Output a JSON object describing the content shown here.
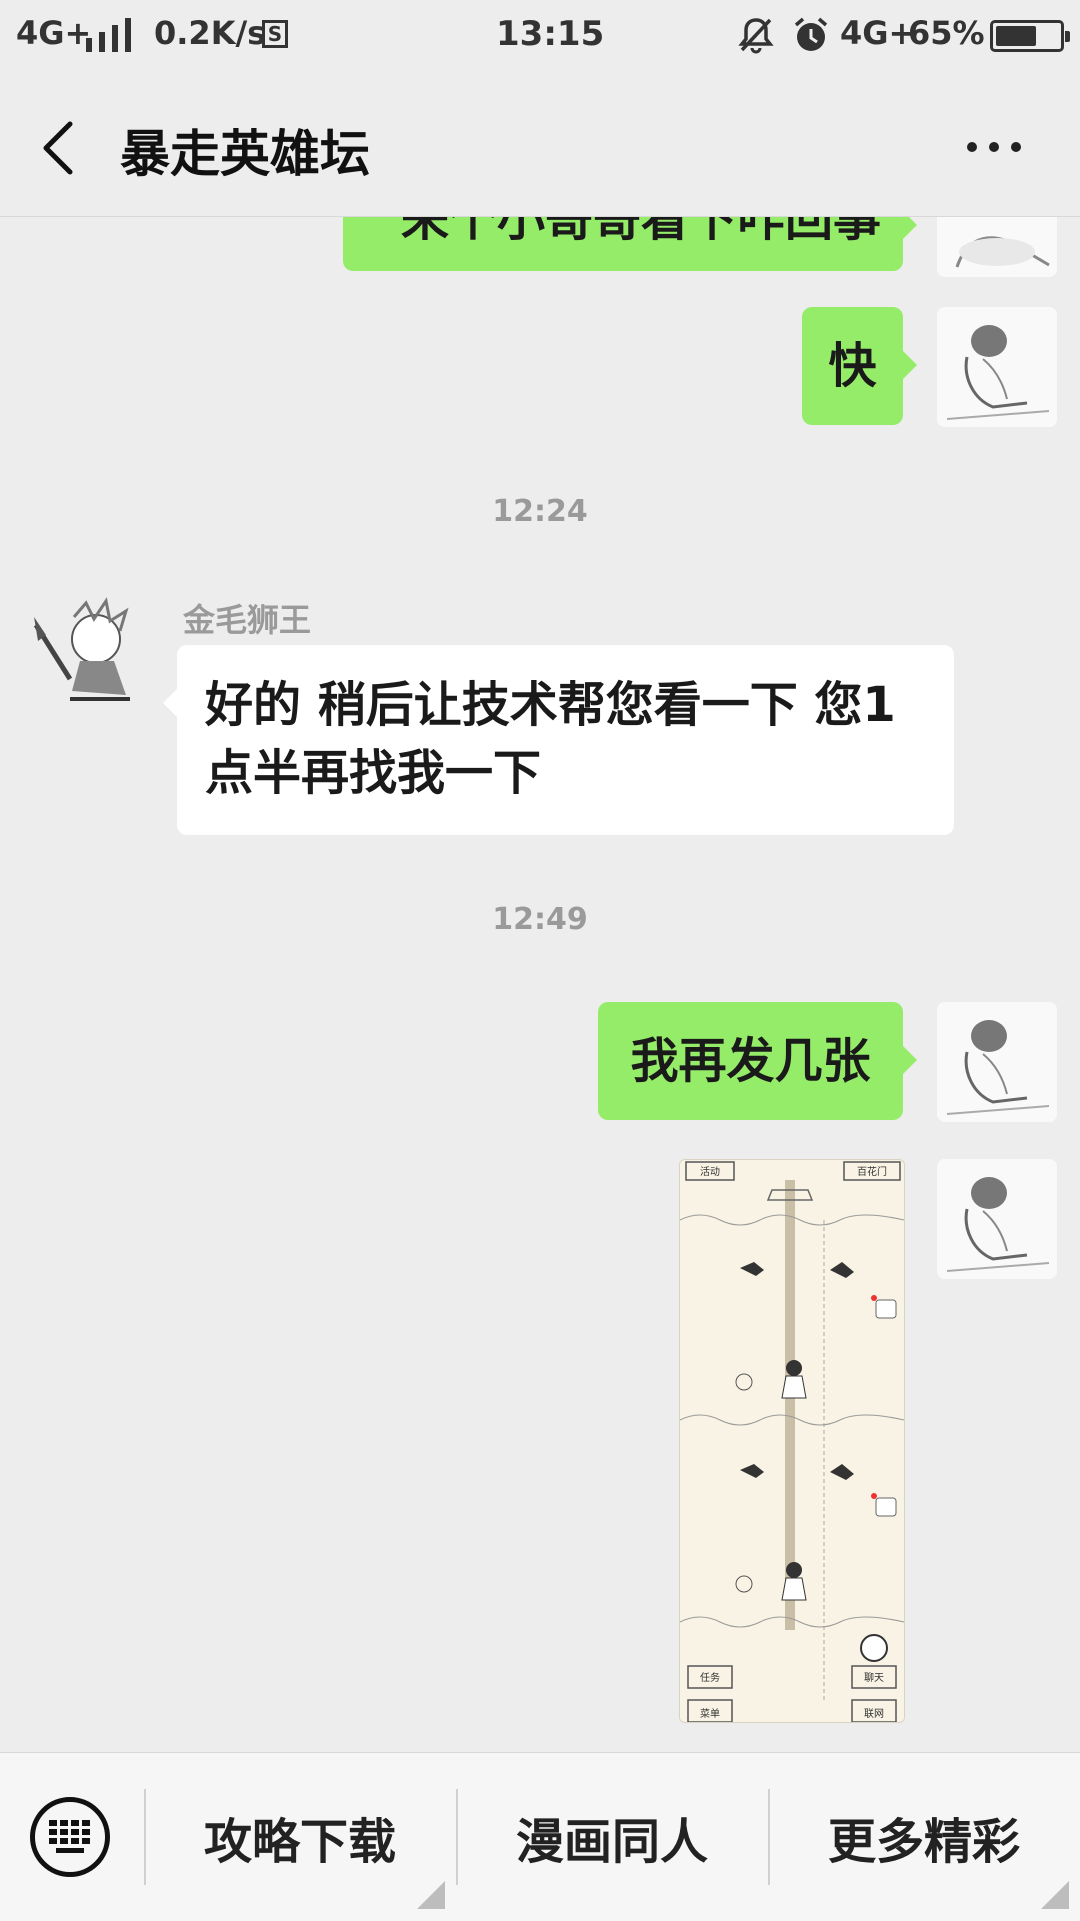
{
  "status_bar": {
    "network": "4G+",
    "speed": "0.2K/s",
    "s_badge": "S",
    "time": "13:15",
    "network2": "4G+",
    "battery_pct": "65%",
    "battery_level": 0.65,
    "icons": [
      "signal-icon",
      "mute-bell-icon",
      "alarm-icon",
      "battery-icon"
    ]
  },
  "header": {
    "title": "暴走英雄坛",
    "back_icon": "chevron-left-icon",
    "more_icon": "more-dots-icon"
  },
  "chat": {
    "messages": [
      {
        "from": "me",
        "text": "来个小哥哥看下咋回事"
      },
      {
        "from": "me",
        "text": "快"
      },
      {
        "timestamp": "12:24"
      },
      {
        "from": "them",
        "sender": "金毛狮王",
        "text": "好的  稍后让技术帮您看一下  您1点半再找我一下"
      },
      {
        "timestamp": "12:49"
      },
      {
        "from": "me",
        "text": "我再发几张"
      },
      {
        "from": "me",
        "image_labels": [
          "活动",
          "百花门",
          "任务",
          "聊天",
          "菜单",
          "联网"
        ]
      }
    ]
  },
  "bottom_bar": {
    "keyboard_icon": "keyboard-icon",
    "menus": [
      "攻略下载",
      "漫画同人",
      "更多精彩"
    ]
  },
  "colors": {
    "my_bubble": "#95ec69",
    "their_bubble": "#ffffff",
    "background": "#ededed"
  }
}
